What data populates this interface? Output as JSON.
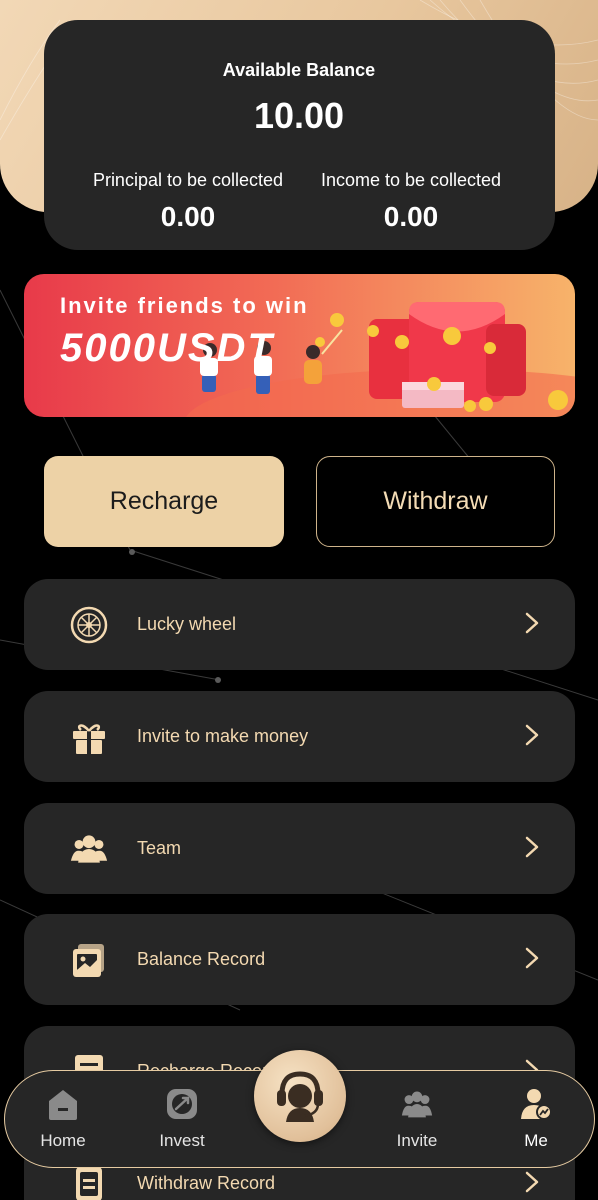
{
  "balance": {
    "title": "Available Balance",
    "value": "10.00",
    "principal_label": "Principal to be collected",
    "principal_value": "0.00",
    "income_label": "Income to be collected",
    "income_value": "0.00"
  },
  "banner": {
    "line1": "Invite friends to win",
    "line2": "5000USDT"
  },
  "actions": {
    "recharge": "Recharge",
    "withdraw": "Withdraw"
  },
  "menu": {
    "items": [
      {
        "label": "Lucky wheel",
        "icon": "wheel-icon"
      },
      {
        "label": "Invite to make money",
        "icon": "gift-icon"
      },
      {
        "label": "Team",
        "icon": "team-icon"
      },
      {
        "label": "Balance Record",
        "icon": "wallet-icon"
      },
      {
        "label": "Recharge Record",
        "icon": "document-icon"
      },
      {
        "label": "Withdraw Record",
        "icon": "clipboard-icon"
      }
    ]
  },
  "tabbar": {
    "home": "Home",
    "invest": "Invest",
    "invite": "Invite",
    "me": "Me",
    "service_icon": "customer-service-icon"
  },
  "colors": {
    "accent": "#edd2a6",
    "card": "#262626",
    "menu_text": "#f3d9b1"
  }
}
